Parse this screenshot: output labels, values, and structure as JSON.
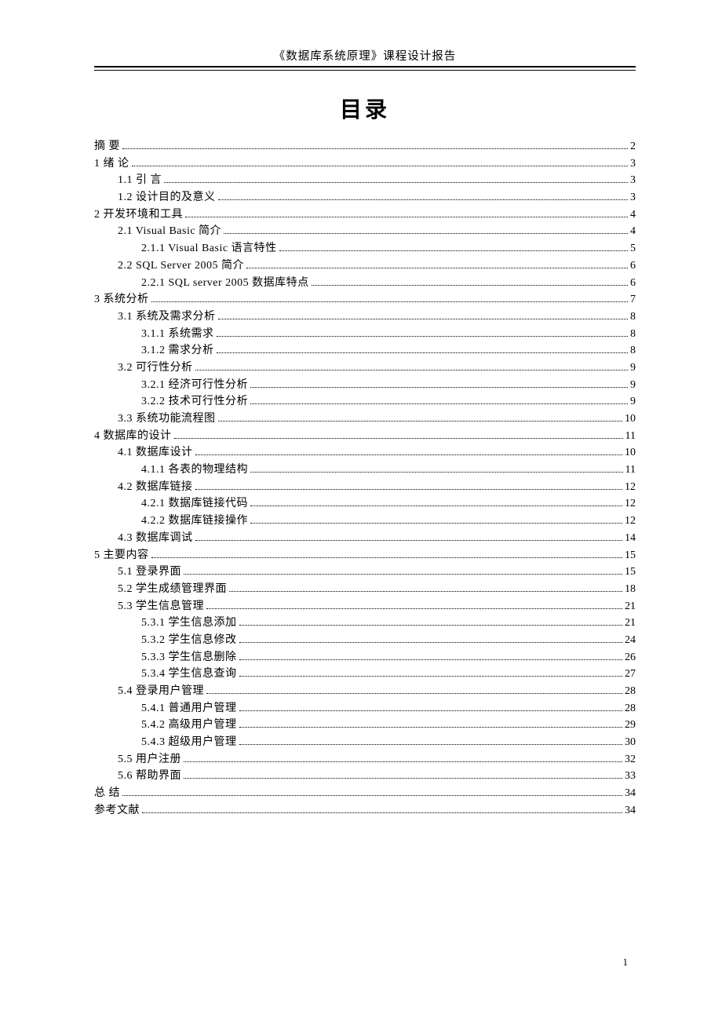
{
  "header": "《数据库系统原理》课程设计报告",
  "title": "目录",
  "page_number": "1",
  "toc": [
    {
      "level": 0,
      "label": "摘 要",
      "page": "2"
    },
    {
      "level": 0,
      "label": "1 绪 论",
      "page": "3"
    },
    {
      "level": 1,
      "label": "1.1 引 言",
      "page": "3"
    },
    {
      "level": 1,
      "label": "1.2 设计目的及意义",
      "page": "3"
    },
    {
      "level": 0,
      "label": "2 开发环境和工具",
      "page": "4"
    },
    {
      "level": 1,
      "label": "2.1 Visual Basic 简介",
      "page": "4"
    },
    {
      "level": 2,
      "label": "2.1.1 Visual Basic 语言特性",
      "page": "5"
    },
    {
      "level": 1,
      "label": "2.2 SQL Server 2005 简介",
      "page": "6"
    },
    {
      "level": 2,
      "label": "2.2.1 SQL server 2005 数据库特点",
      "page": "6"
    },
    {
      "level": 0,
      "label": "3 系统分析",
      "page": "7"
    },
    {
      "level": 1,
      "label": "3.1 系统及需求分析",
      "page": "8"
    },
    {
      "level": 2,
      "label": "3.1.1 系统需求",
      "page": "8"
    },
    {
      "level": 2,
      "label": "3.1.2 需求分析",
      "page": "8"
    },
    {
      "level": 1,
      "label": "3.2  可行性分析",
      "page": "9"
    },
    {
      "level": 2,
      "label": "3.2.1 经济可行性分析",
      "page": "9"
    },
    {
      "level": 2,
      "label": "3.2.2 技术可行性分析",
      "page": "9"
    },
    {
      "level": 1,
      "label": "3.3 系统功能流程图",
      "page": "10"
    },
    {
      "level": 0,
      "label": "4 数据库的设计",
      "page": "11"
    },
    {
      "level": 1,
      "label": "4.1 数据库设计",
      "page": "10"
    },
    {
      "level": 2,
      "label": "4.1.1 各表的物理结构",
      "page": "11"
    },
    {
      "level": 1,
      "label": "4.2 数据库链接",
      "page": "12"
    },
    {
      "level": 2,
      "label": "4.2.1 数据库链接代码",
      "page": "12"
    },
    {
      "level": 2,
      "label": "4.2.2 数据库链接操作",
      "page": "12"
    },
    {
      "level": 1,
      "label": "4.3 数据库调试",
      "page": "14"
    },
    {
      "level": 0,
      "label": "5 主要内容",
      "page": "15"
    },
    {
      "level": 1,
      "label": "5.1 登录界面",
      "page": "15"
    },
    {
      "level": 1,
      "label": "5.2 学生成绩管理界面",
      "page": "18"
    },
    {
      "level": 1,
      "label": "5.3 学生信息管理",
      "page": "21"
    },
    {
      "level": 2,
      "label": "5.3.1 学生信息添加",
      "page": "21"
    },
    {
      "level": 2,
      "label": "5.3.2 学生信息修改",
      "page": "24"
    },
    {
      "level": 2,
      "label": "5.3.3 学生信息删除",
      "page": "26"
    },
    {
      "level": 2,
      "label": "5.3.4 学生信息查询",
      "page": "27"
    },
    {
      "level": 1,
      "label": "5.4 登录用户管理",
      "page": "28"
    },
    {
      "level": 2,
      "label": "5.4.1 普通用户管理",
      "page": "28"
    },
    {
      "level": 2,
      "label": "5.4.2 高级用户管理",
      "page": "29"
    },
    {
      "level": 2,
      "label": "5.4.3 超级用户管理",
      "page": "30"
    },
    {
      "level": 1,
      "label": "5.5 用户注册",
      "page": "32"
    },
    {
      "level": 1,
      "label": "5.6 帮助界面",
      "page": "33"
    },
    {
      "level": 0,
      "label": "总 结",
      "page": "34"
    },
    {
      "level": 0,
      "label": "参考文献",
      "page": "34"
    }
  ]
}
